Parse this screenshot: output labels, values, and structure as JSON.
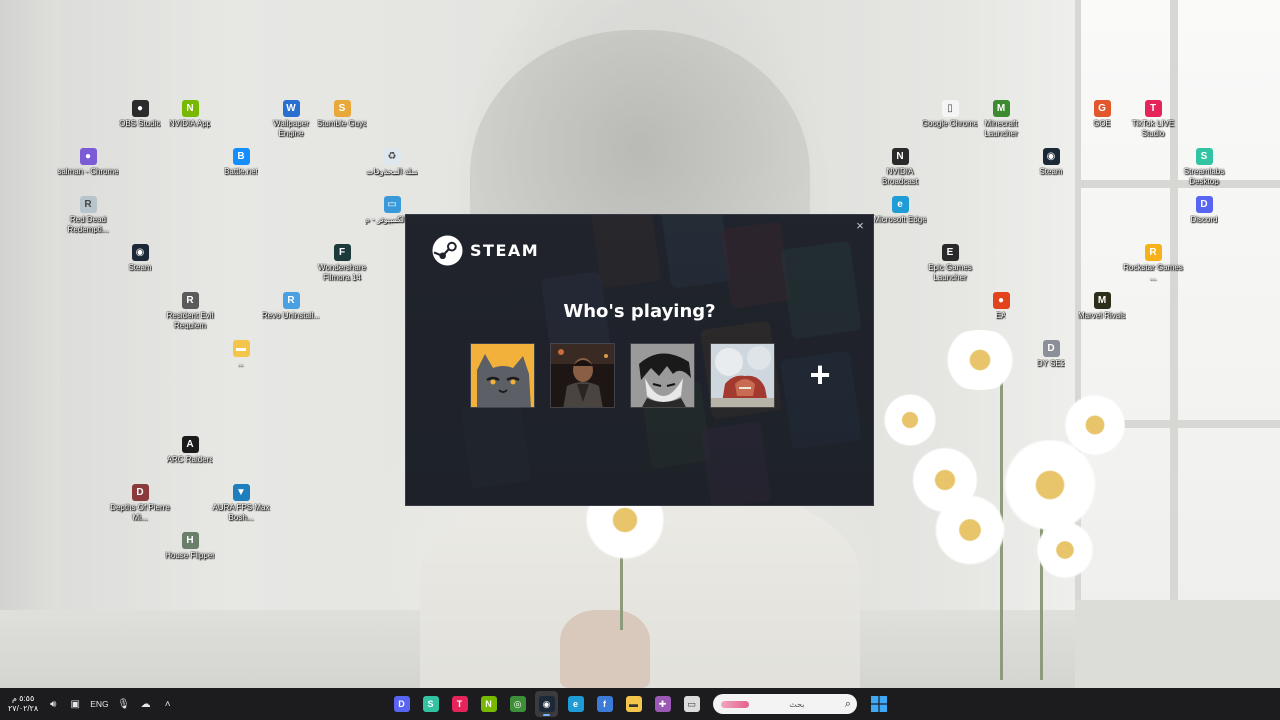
{
  "desktop_icons": [
    {
      "label": "OBS Studio",
      "icon": "obs-icon",
      "color": "#2b2b2b",
      "glyph": "●"
    },
    {
      "label": "NVIDIA App",
      "icon": "nvidia-icon",
      "color": "#76b900",
      "glyph": "N"
    },
    {
      "label": "Wallpaper Engine",
      "icon": "wallpaper-engine-icon",
      "color": "#2a6fcf",
      "glyph": "W"
    },
    {
      "label": "Stumble Guys",
      "icon": "stumble-guys-icon",
      "color": "#e9a93a",
      "glyph": "S"
    },
    {
      "label": "salman - Chrome",
      "icon": "chrome-profile-icon",
      "color": "#7b5bd6",
      "glyph": "●"
    },
    {
      "label": "Battle.net",
      "icon": "battle-net-icon",
      "color": "#148eff",
      "glyph": "B"
    },
    {
      "label": "سلة المحذوفات",
      "icon": "recycle-bin-icon",
      "color": "#dfe7ee",
      "glyph": "♻"
    },
    {
      "label": "Red Dead Redempti...",
      "icon": "red-dead-icon",
      "color": "#b8c4cc",
      "glyph": "R"
    },
    {
      "label": "هذا الكمبيوتر - م",
      "icon": "this-pc-icon",
      "color": "#3a9ad9",
      "glyph": "▭"
    },
    {
      "label": "Steam",
      "icon": "steam-icon",
      "color": "#1b2838",
      "glyph": "◉"
    },
    {
      "label": "Wondershare Filmora 14",
      "icon": "filmora-icon",
      "color": "#1d3a3a",
      "glyph": "F"
    },
    {
      "label": "Resident Evil Requiem",
      "icon": "resident-evil-icon",
      "color": "#5a5a5a",
      "glyph": "R"
    },
    {
      "label": "Revo Uninstall...",
      "icon": "revo-uninstaller-icon",
      "color": "#4aa0e0",
      "glyph": "R"
    },
    {
      "label": "...",
      "icon": "folder-icon",
      "color": "#f3c64b",
      "glyph": "▬"
    },
    {
      "label": "ARC Raiders",
      "icon": "arc-raiders-icon",
      "color": "#1a1a1a",
      "glyph": "A"
    },
    {
      "label": "Depths Of Pierre Mi...",
      "icon": "depths-icon",
      "color": "#8a3a3a",
      "glyph": "D"
    },
    {
      "label": "AURA FPS Max Bosh...",
      "icon": "aura-fps-icon",
      "color": "#1e7fbf",
      "glyph": "▼"
    },
    {
      "label": "House Flipper",
      "icon": "house-flipper-icon",
      "color": "#6a7f6a",
      "glyph": "H"
    },
    {
      "label": "Google Chrome",
      "icon": "google-chrome-doc-icon",
      "color": "#f5f5f5",
      "glyph": "▯"
    },
    {
      "label": "Minecraft Launcher",
      "icon": "minecraft-icon",
      "color": "#3c8c2f",
      "glyph": "M"
    },
    {
      "label": "GOE",
      "icon": "goe-icon",
      "color": "#e2572b",
      "glyph": "G"
    },
    {
      "label": "TikTok LIVE Studio",
      "icon": "tiktok-live-icon",
      "color": "#e5245b",
      "glyph": "T"
    },
    {
      "label": "NVIDIA Broadcast",
      "icon": "nvidia-broadcast-icon",
      "color": "#2a2a2a",
      "glyph": "N"
    },
    {
      "label": "Steam",
      "icon": "steam-icon",
      "color": "#1b2838",
      "glyph": "◉"
    },
    {
      "label": "Streamlabs Desktop",
      "icon": "streamlabs-icon",
      "color": "#31c3a2",
      "glyph": "S"
    },
    {
      "label": "Microsoft Edge",
      "icon": "edge-icon",
      "color": "#1f9bd6",
      "glyph": "e"
    },
    {
      "label": "Discord",
      "icon": "discord-icon",
      "color": "#5865f2",
      "glyph": "D"
    },
    {
      "label": "Epic Games Launcher",
      "icon": "epic-games-icon",
      "color": "#2a2a2a",
      "glyph": "E"
    },
    {
      "label": "Rockstar Games ...",
      "icon": "rockstar-icon",
      "color": "#f6b21a",
      "glyph": "R"
    },
    {
      "label": "EA",
      "icon": "ea-icon",
      "color": "#e2431c",
      "glyph": "●"
    },
    {
      "label": "Marvel Rivals",
      "icon": "marvel-rivals-icon",
      "color": "#2d2d1a",
      "glyph": "M"
    },
    {
      "label": "DY SE2",
      "icon": "dyse2-icon",
      "color": "#8a8f98",
      "glyph": "D"
    }
  ],
  "steam_dialog": {
    "brand": "STEAM",
    "heading": "Who's playing?",
    "close_glyph": "×",
    "add_glyph": "+",
    "accent": "#1b2838",
    "profiles": [
      {
        "name": "cat-avatar",
        "color": "#f2b13a"
      },
      {
        "name": "person-avatar",
        "color": "#2a1f1c"
      },
      {
        "name": "manga-avatar",
        "color": "#8b8b8b"
      },
      {
        "name": "titan-avatar",
        "color": "#c9d4dc"
      }
    ]
  },
  "taskbar": {
    "clock_time": "٥:٥٥ م",
    "clock_date": "٢٧/٠٢/٢٨",
    "language": "ENG",
    "search_placeholder": "بحث",
    "apps": [
      {
        "icon": "discord-icon",
        "color": "#5865f2",
        "glyph": "D"
      },
      {
        "icon": "streamlabs-icon",
        "color": "#31c3a2",
        "glyph": "S"
      },
      {
        "icon": "tiktok-live-icon",
        "color": "#e5245b",
        "glyph": "T"
      },
      {
        "icon": "nvidia-icon",
        "color": "#76b900",
        "glyph": "N"
      },
      {
        "icon": "chrome-icon",
        "color": "#3f8f3a",
        "glyph": "◎"
      },
      {
        "icon": "steam-icon",
        "color": "#1b2838",
        "glyph": "◉",
        "active": true
      },
      {
        "icon": "edge-icon",
        "color": "#1f9bd6",
        "glyph": "e"
      },
      {
        "icon": "file-icon",
        "color": "#3d7bd9",
        "glyph": "f"
      },
      {
        "icon": "file-explorer-icon",
        "color": "#f3c64b",
        "glyph": "▬"
      },
      {
        "icon": "colorful-app-icon",
        "color": "#9b59b6",
        "glyph": "✚"
      },
      {
        "icon": "notepad-icon",
        "color": "#dcdcdc",
        "glyph": "▭"
      }
    ],
    "start_icon": "windows-start-icon"
  }
}
